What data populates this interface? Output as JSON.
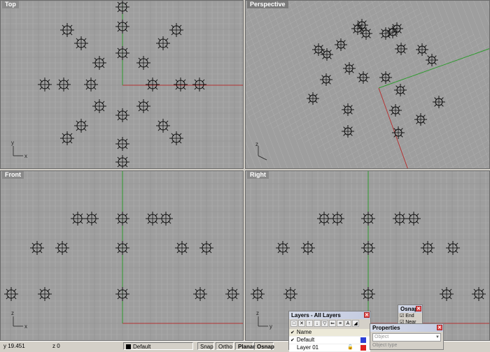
{
  "viewports": {
    "top": {
      "title": "Top"
    },
    "perspective": {
      "title": "Perspective"
    },
    "front": {
      "title": "Front"
    },
    "right": {
      "title": "Right"
    }
  },
  "axis_labels": {
    "x": "x",
    "y": "y",
    "z": "z"
  },
  "status": {
    "y_coord": "y 19.451",
    "z_coord": "z 0",
    "layer": "Default",
    "snap": "Snap",
    "ortho": "Ortho",
    "planar": "Planar",
    "osnap": "Osnap"
  },
  "layers_panel": {
    "title": "Layers - All Layers",
    "column_name": "Name",
    "rows": [
      {
        "name": "Default",
        "checked": true
      },
      {
        "name": "Layer 01",
        "checked": false
      }
    ]
  },
  "osnap_panel": {
    "title": "Osnap",
    "items": [
      "End",
      "Near"
    ]
  },
  "properties_panel": {
    "title": "Properties",
    "field1": "Object",
    "field2": "Object type"
  },
  "colors": {
    "viewport_bg": "#9e9e9e",
    "grid": "#b0b0b0",
    "x_axis": "#b33333",
    "y_axis": "#2f9a2f"
  },
  "icons": [
    "close-icon",
    "gear-object-icon",
    "new-layer-icon",
    "delete-icon",
    "up-icon",
    "down-icon",
    "filter-icon",
    "tools-icon"
  ]
}
